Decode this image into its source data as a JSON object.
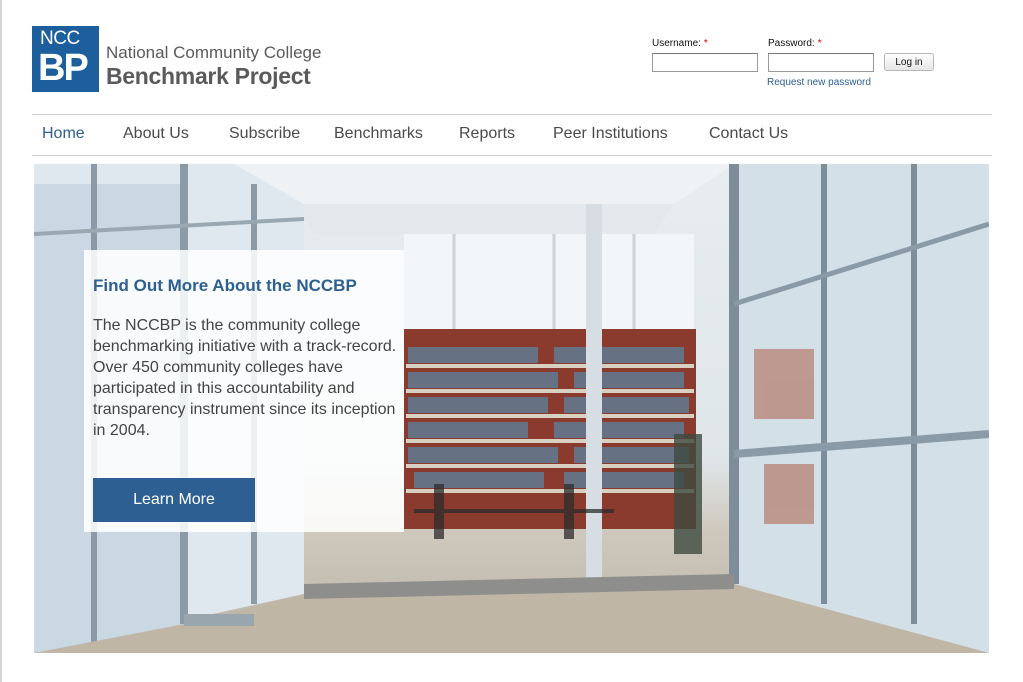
{
  "logo": {
    "top_text": "NCC",
    "big_text": "BP",
    "line1": "National Community College",
    "line2": "Benchmark Project"
  },
  "login": {
    "username_label": "Username:",
    "password_label": "Password:",
    "required_mark": "*",
    "username_value": "",
    "password_value": "",
    "login_button": "Log in",
    "request_password": "Request new password"
  },
  "nav": {
    "items": [
      {
        "label": "Home"
      },
      {
        "label": "About Us"
      },
      {
        "label": "Subscribe"
      },
      {
        "label": "Benchmarks"
      },
      {
        "label": "Reports"
      },
      {
        "label": "Peer Institutions"
      },
      {
        "label": "Contact Us"
      }
    ],
    "active": "Home"
  },
  "hero": {
    "title": "Find Out More About the NCCBP",
    "text": "The NCCBP is the community college benchmarking initiative with a track-record. Over 450 community colleges have participated in this accountability and transparency instrument since its inception in 2004.",
    "button": "Learn More"
  },
  "colors": {
    "brand_blue": "#1d5f9c",
    "link_blue": "#2c5f93",
    "nav_text": "#4a4a4a"
  }
}
